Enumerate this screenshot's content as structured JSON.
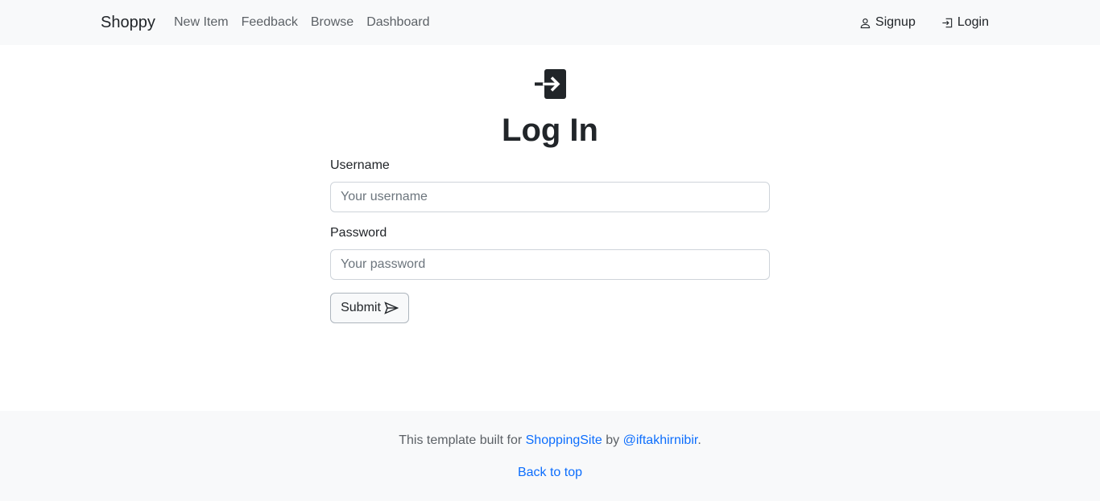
{
  "navbar": {
    "brand": "Shoppy",
    "links": [
      "New Item",
      "Feedback",
      "Browse",
      "Dashboard"
    ],
    "right": [
      {
        "label": "Signup",
        "icon": "person-icon"
      },
      {
        "label": "Login",
        "icon": "login-icon"
      }
    ]
  },
  "main": {
    "icon": "box-arrow-in-right-icon",
    "title": "Log In",
    "username_label": "Username",
    "username_placeholder": "Your username",
    "password_label": "Password",
    "password_placeholder": "Your password",
    "submit_label": "Submit"
  },
  "footer": {
    "prefix": "This template built for ",
    "site_link": "ShoppingSite",
    "middle": " by ",
    "author_link": "@iftakhirnibir",
    "suffix": ".",
    "back_to_top": "Back to top"
  },
  "colors": {
    "navbar_bg": "#f8f9fa",
    "link": "#0d6efd",
    "text": "#212529"
  }
}
